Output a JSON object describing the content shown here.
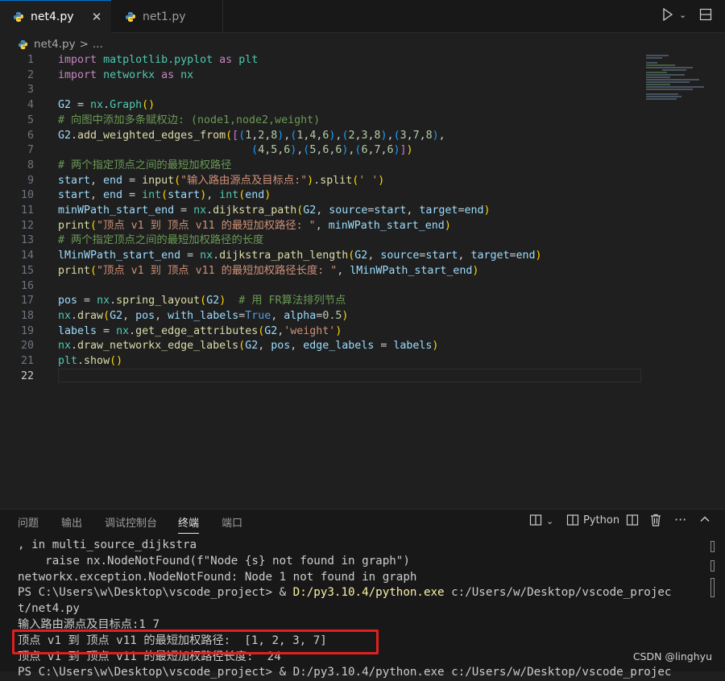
{
  "tabs": [
    {
      "label": "net4.py",
      "active": true
    },
    {
      "label": "net1.py",
      "active": false
    }
  ],
  "breadcrumb": {
    "file": "net4.py",
    "separator": ">",
    "more": "..."
  },
  "editor": {
    "line_numbers": [
      "1",
      "2",
      "3",
      "4",
      "5",
      "6",
      "7",
      "8",
      "9",
      "10",
      "11",
      "12",
      "13",
      "14",
      "15",
      "16",
      "17",
      "18",
      "19",
      "20",
      "21",
      "22"
    ],
    "current_line": "22"
  },
  "panel": {
    "tabs": [
      "问题",
      "输出",
      "调试控制台",
      "终端",
      "端口"
    ],
    "active_tab": "终端",
    "shell_label": "Python",
    "terminal_lines": [
      ", in multi_source_dijkstra",
      "    raise nx.NodeNotFound(f\"Node {s} not found in graph\")",
      "networkx.exception.NodeNotFound: Node 1 not found in graph",
      "PS C:\\Users\\w\\Desktop\\vscode_project> & ",
      "D:/py3.10.4/python.exe",
      " c:/Users/w/Desktop/vscode_projec",
      "t/net4.py",
      "输入路由源点及目标点:1 7",
      "顶点 v1 到 顶点 v11 的最短加权路径:  [1, 2, 3, 7]",
      "顶点 v1 到 顶点 v11 的最短加权路径长度:  24",
      "PS C:\\Users\\w\\Desktop\\vscode_project> & D:/py3.10.4/python.exe c:/Users/w/Desktop/vscode_projec"
    ]
  },
  "watermark": "CSDN @linghyu",
  "colors": {
    "accent": "#0078d4",
    "highlight_box": "#e0201e",
    "editor_bg": "#1f1f1f",
    "panel_bg": "#181818"
  }
}
